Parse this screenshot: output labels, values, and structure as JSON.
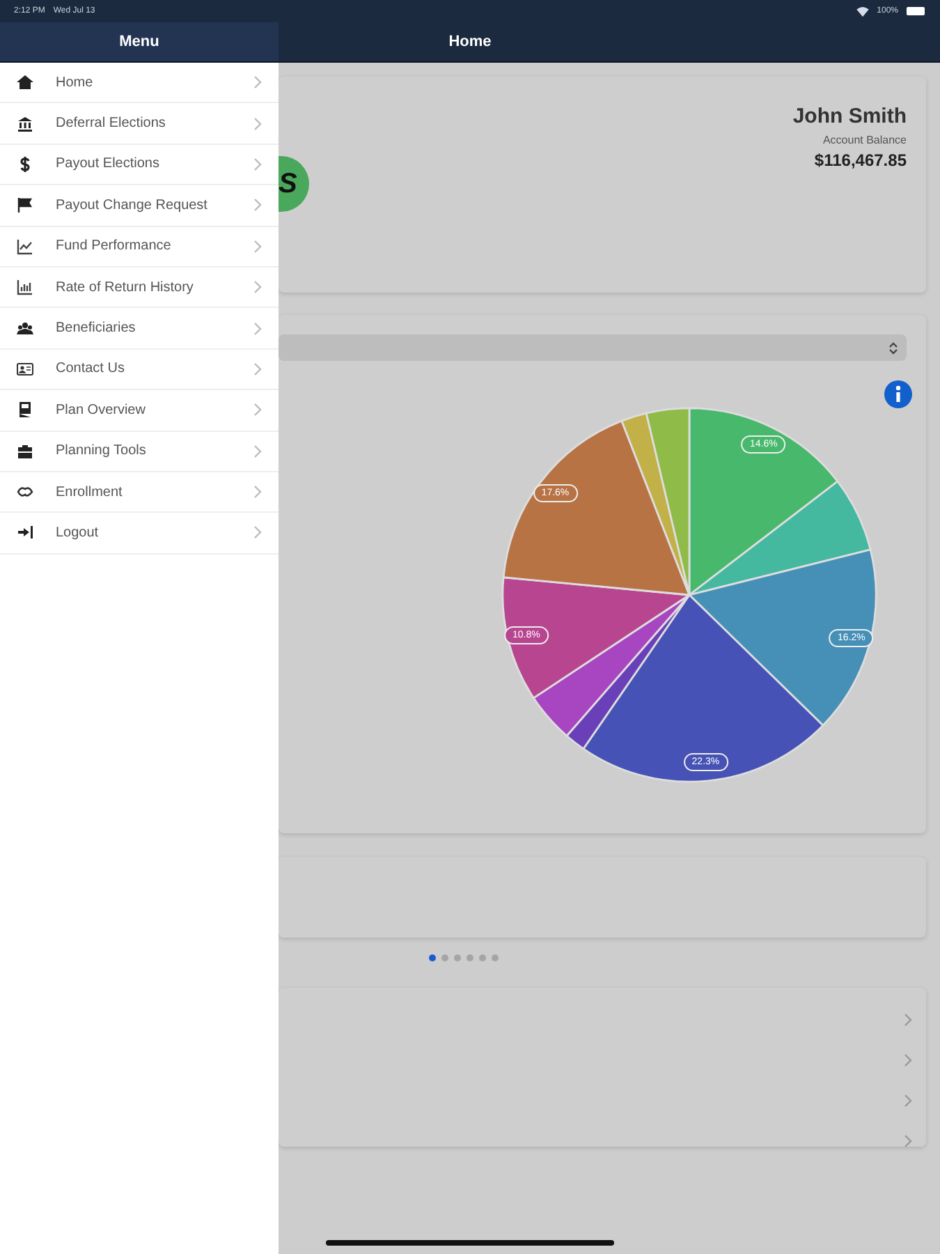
{
  "status_bar": {
    "time": "2:12 PM",
    "date": "Wed Jul 13",
    "battery": "100%"
  },
  "menu": {
    "title": "Menu",
    "items": [
      {
        "label": "Home"
      },
      {
        "label": "Deferral Elections"
      },
      {
        "label": "Payout Elections"
      },
      {
        "label": "Payout Change Request"
      },
      {
        "label": "Fund Performance"
      },
      {
        "label": "Rate of Return History"
      },
      {
        "label": "Beneficiaries"
      },
      {
        "label": "Contact Us"
      },
      {
        "label": "Plan Overview"
      },
      {
        "label": "Planning Tools"
      },
      {
        "label": "Enrollment"
      },
      {
        "label": "Logout"
      }
    ]
  },
  "header": {
    "title": "Home"
  },
  "account_card": {
    "logo_text": "S",
    "name": "John Smith",
    "balance_label": "Account Balance",
    "balance": "$116,467.85"
  },
  "allocation_card": {
    "chart_data": {
      "type": "pie",
      "values": [
        14.6,
        6.5,
        16.2,
        22.3,
        1.8,
        4.3,
        10.8,
        17.6,
        2.2,
        3.7
      ],
      "colors": [
        "#48b86c",
        "#45b8a0",
        "#4690b8",
        "#4652b5",
        "#6a40b8",
        "#a845c0",
        "#b84590",
        "#b87345",
        "#c2b048",
        "#8fbb48"
      ],
      "value_labels": [
        "14.6%",
        null,
        "16.2%",
        "22.3%",
        null,
        null,
        "10.8%",
        "17.6%",
        null,
        null
      ]
    }
  },
  "pager": {
    "dots": [
      {
        "selected": true
      },
      {
        "selected": false
      },
      {
        "selected": false
      },
      {
        "selected": false
      },
      {
        "selected": false
      },
      {
        "selected": false
      }
    ]
  }
}
